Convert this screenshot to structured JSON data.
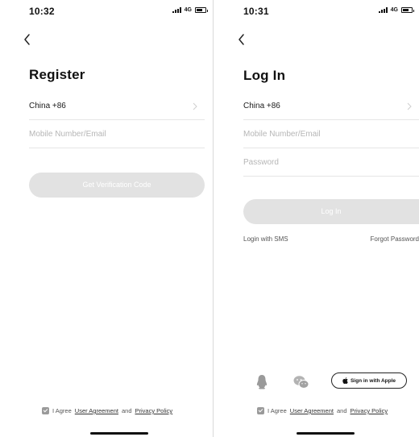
{
  "register": {
    "status_time": "10:32",
    "network": "4G",
    "title": "Register",
    "country": "China +86",
    "contact_placeholder": "Mobile Number/Email",
    "submit_label": "Get Verification Code",
    "agree_prefix": "I Agree",
    "agreement_link": "User Agreement",
    "agree_and": "and",
    "privacy_link": "Privacy Policy"
  },
  "login": {
    "status_time": "10:31",
    "network": "4G",
    "title": "Log In",
    "country": "China +86",
    "contact_placeholder": "Mobile Number/Email",
    "password_placeholder": "Password",
    "submit_label": "Log In",
    "sms_link": "Login with SMS",
    "forgot_link": "Forgot Password",
    "social_icons": [
      "qq-icon",
      "wechat-icon",
      "apple-icon"
    ],
    "apple_label": "Sign in with Apple",
    "agree_prefix": "I Agree",
    "agreement_link": "User Agreement",
    "agree_and": "and",
    "privacy_link": "Privacy Policy"
  },
  "colors": {
    "button_disabled": "#e2e2e2",
    "placeholder": "#b6b6b6",
    "divider": "#e6e6e6",
    "checkbox": "#9a9a9a"
  }
}
